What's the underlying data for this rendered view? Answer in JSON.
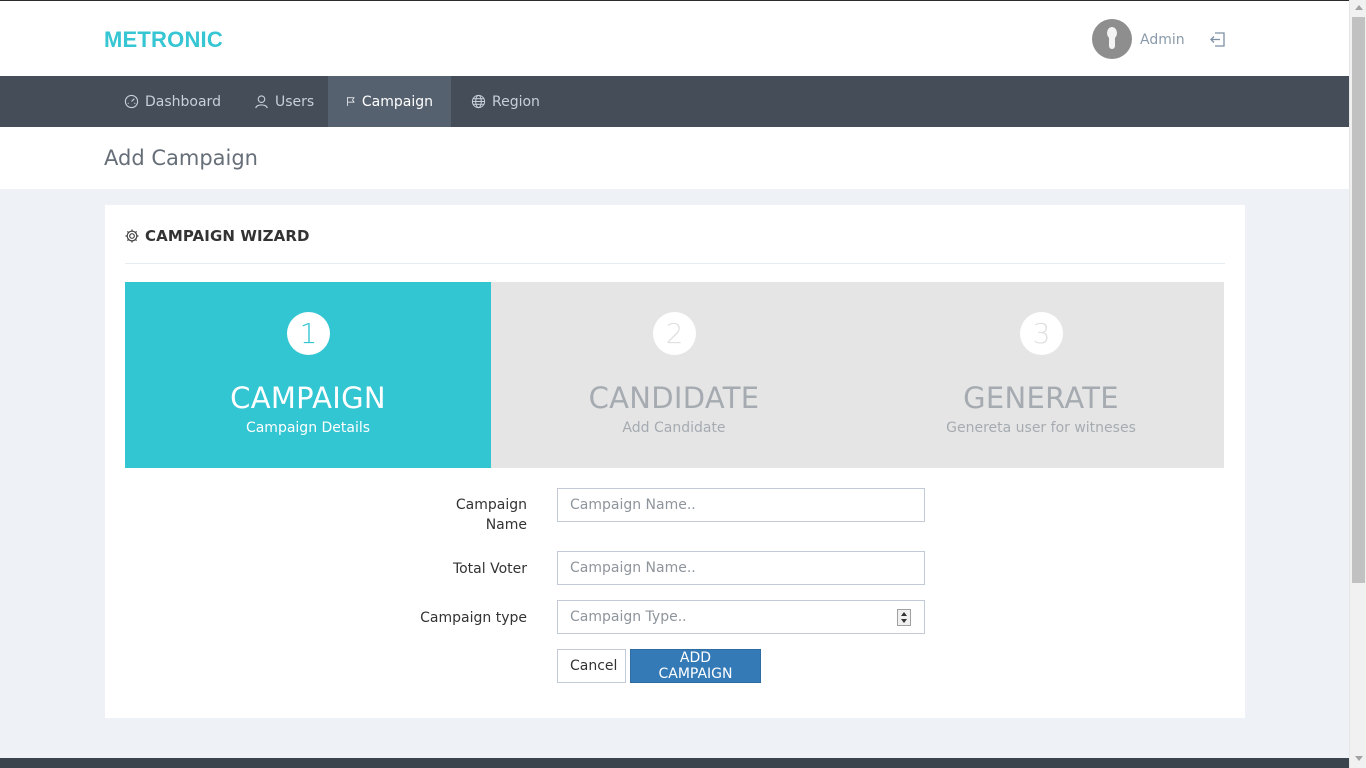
{
  "brand": {
    "logo_text": "METRONIC",
    "accent_color": "#36c6d3"
  },
  "user": {
    "name": "Admin",
    "avatar_icon": "user-avatar-icon",
    "logout_icon": "logout-icon"
  },
  "nav": {
    "items": [
      {
        "label": "Dashboard",
        "icon": "speedometer-icon",
        "active": false
      },
      {
        "label": "Users",
        "icon": "users-icon",
        "active": false
      },
      {
        "label": "Campaign",
        "icon": "flag-icon",
        "active": true
      },
      {
        "label": "Region",
        "icon": "globe-icon",
        "active": false
      }
    ]
  },
  "page": {
    "title": "Add Campaign"
  },
  "wizard": {
    "title": "CAMPAIGN WIZARD",
    "title_icon": "gear-icon",
    "steps": [
      {
        "number": "1",
        "title": "CAMPAIGN",
        "subtitle": "Campaign Details",
        "active": true
      },
      {
        "number": "2",
        "title": "CANDIDATE",
        "subtitle": "Add Candidate",
        "active": false
      },
      {
        "number": "3",
        "title": "GENERATE",
        "subtitle": "Genereta user for witneses",
        "active": false
      }
    ]
  },
  "form": {
    "campaign_name": {
      "label_line1": "Campaign",
      "label_line2": "Name",
      "placeholder": "Campaign Name..",
      "value": ""
    },
    "total_voter": {
      "label": "Total Voter",
      "placeholder": "Campaign Name..",
      "value": ""
    },
    "campaign_type": {
      "label": "Campaign type",
      "placeholder": "Campaign Type..",
      "value": ""
    },
    "cancel_label": "Cancel",
    "submit_label": "ADD CAMPAIGN"
  },
  "colors": {
    "nav_bg": "#444d58",
    "nav_active": "#55616f",
    "step_active": "#32c5d2",
    "primary_button": "#337ab7"
  }
}
